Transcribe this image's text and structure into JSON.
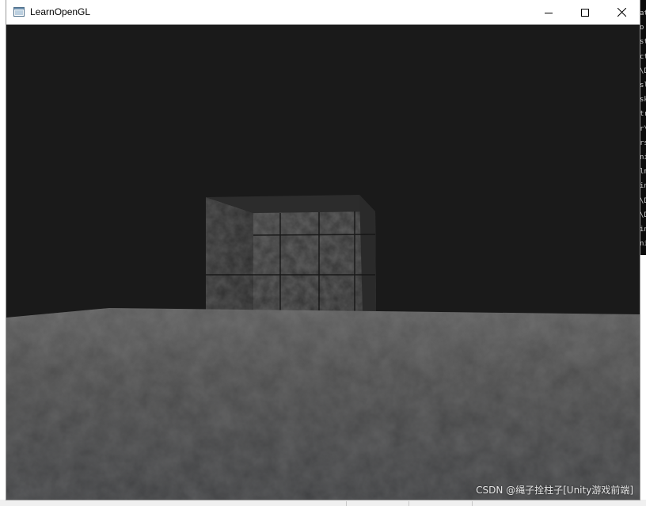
{
  "window": {
    "title": "LearnOpenGL",
    "minimize_icon": "minimize-icon",
    "maximize_icon": "maximize-icon",
    "close_icon": "close-icon",
    "app_icon": "app-window-icon"
  },
  "scene": {
    "background_color": "#1a1a1a",
    "floor_color": "#4a4a4a",
    "cube_color": "#3a3a3a"
  },
  "watermark": {
    "text": "CSDN @绳子拴柱子[Unity游戏前端]"
  },
  "background_console": {
    "lines": [
      "at",
      "o",
      "st",
      "ct",
      "\\D",
      "sl",
      "sk",
      "tr",
      "r\\",
      "rs",
      "ni",
      "lm",
      "in",
      "\\D",
      "\\D",
      "in",
      "ni"
    ]
  }
}
